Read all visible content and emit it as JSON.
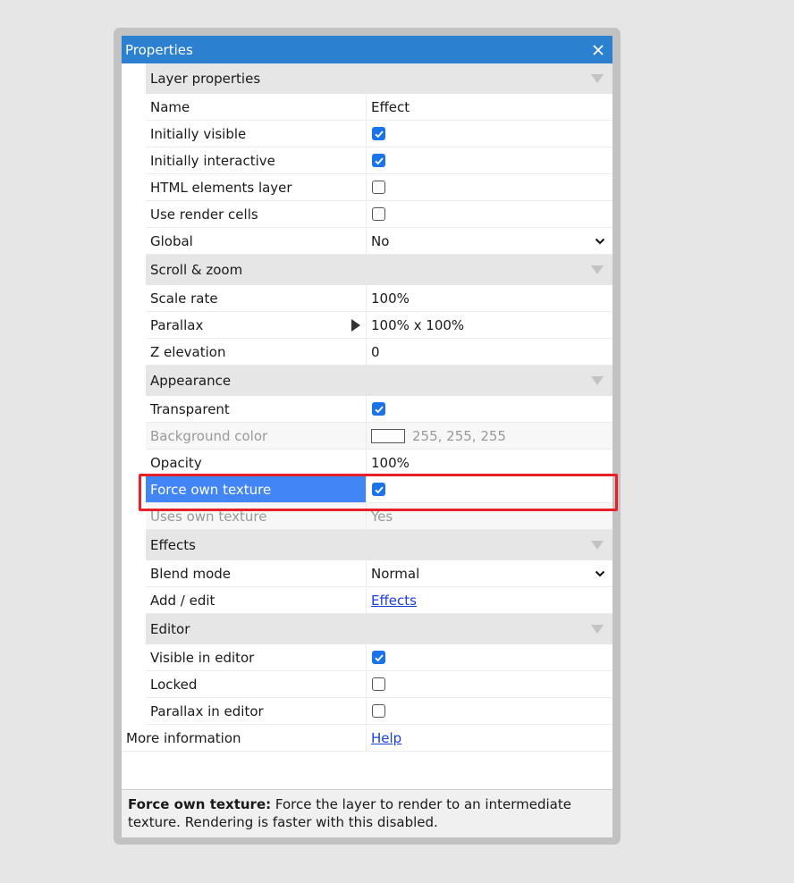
{
  "panel": {
    "title": "Properties",
    "accent_color": "#2b80d0",
    "selection_color": "#4285f4",
    "close_icon": "close-icon"
  },
  "sections": {
    "layer": {
      "title": "Layer properties",
      "name_label": "Name",
      "name_value": "Effect",
      "visible_label": "Initially visible",
      "visible_checked": true,
      "interactive_label": "Initially interactive",
      "interactive_checked": true,
      "html_label": "HTML elements layer",
      "html_checked": false,
      "render_cells_label": "Use render cells",
      "render_cells_checked": false,
      "global_label": "Global",
      "global_value": "No"
    },
    "scroll": {
      "title": "Scroll & zoom",
      "scale_label": "Scale rate",
      "scale_value": "100%",
      "parallax_label": "Parallax",
      "parallax_value": "100% x 100%",
      "z_label": "Z elevation",
      "z_value": "0"
    },
    "appearance": {
      "title": "Appearance",
      "transparent_label": "Transparent",
      "transparent_checked": true,
      "bg_label": "Background color",
      "bg_value": "255, 255, 255",
      "opacity_label": "Opacity",
      "opacity_value": "100%",
      "force_label": "Force own texture",
      "force_checked": true,
      "uses_label": "Uses own texture",
      "uses_value": "Yes"
    },
    "effects": {
      "title": "Effects",
      "blend_label": "Blend mode",
      "blend_value": "Normal",
      "add_label": "Add / edit",
      "add_link": "Effects"
    },
    "editor": {
      "title": "Editor",
      "visible_label": "Visible in editor",
      "visible_checked": true,
      "locked_label": "Locked",
      "locked_checked": false,
      "parallax_label": "Parallax in editor",
      "parallax_checked": false
    }
  },
  "more": {
    "label": "More information",
    "link": "Help"
  },
  "footer": {
    "term": "Force own texture:",
    "description": " Force the layer to render to an intermediate texture. Rendering is faster with this disabled."
  }
}
